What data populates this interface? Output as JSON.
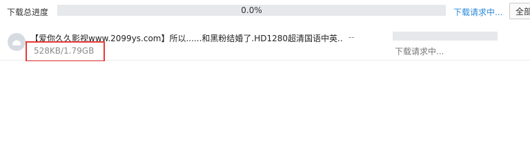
{
  "total": {
    "label": "下载总进度",
    "percent_text": "0.0%",
    "progress_fraction": 0.0,
    "status": "下载请求中...",
    "start_all_label": "全部开始"
  },
  "tasks": [
    {
      "name": "【爱你久久影视www.2099ys.com】所以......和黑粉结婚了.HD1280超清国语中英...",
      "speed": "--",
      "size": "528KB/1.79GB",
      "progress_fraction": 0.0,
      "status": "下载请求中..."
    }
  ],
  "icons": {
    "file_icon": "cloud-file-icon"
  },
  "colors": {
    "progress_track": "#e6e8ec",
    "status_link": "#2b88d8",
    "highlight_box": "#e53935"
  }
}
